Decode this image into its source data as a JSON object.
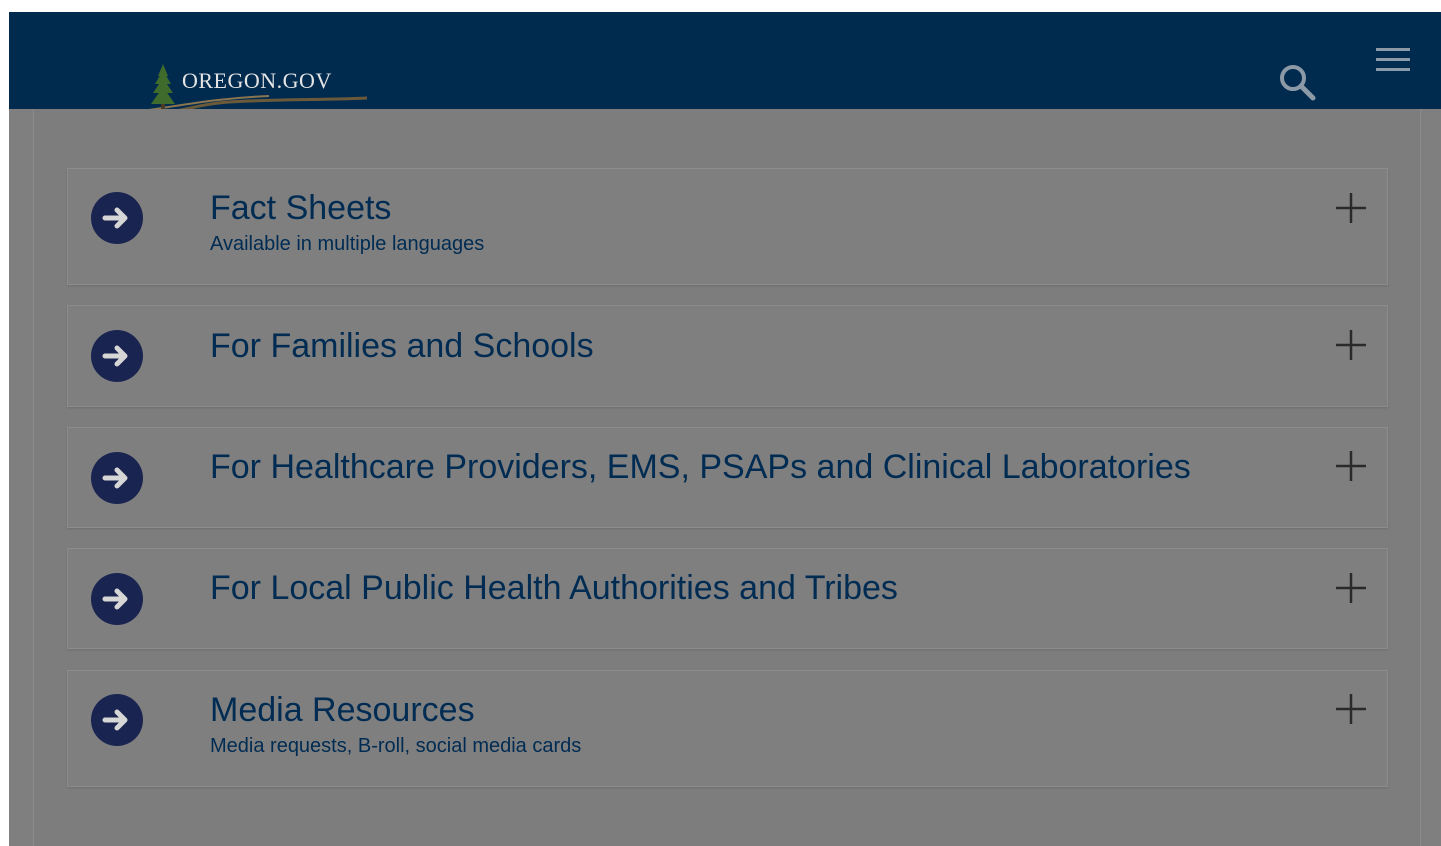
{
  "header": {
    "logo_text": "Oregon.gov",
    "search_icon": "search-icon",
    "menu_icon": "hamburger-menu-icon"
  },
  "accordion": {
    "items": [
      {
        "title": "Fact Sheets",
        "subtitle": "Available in multiple languages"
      },
      {
        "title": "For Families and Schools",
        "subtitle": ""
      },
      {
        "title": "For Healthcare Providers, EMS, PSAPs and Clinical Laboratories",
        "subtitle": ""
      },
      {
        "title": "For Local Public Health Authorities and Tribes",
        "subtitle": ""
      },
      {
        "title": "Media Resources",
        "subtitle": "Media requests, B-roll, social media cards"
      }
    ]
  },
  "colors": {
    "header_bg": "#002b4f",
    "overlay_bg": "#7f7f7f",
    "link_text": "#002b52",
    "arrow_circle": "#1a2450"
  }
}
